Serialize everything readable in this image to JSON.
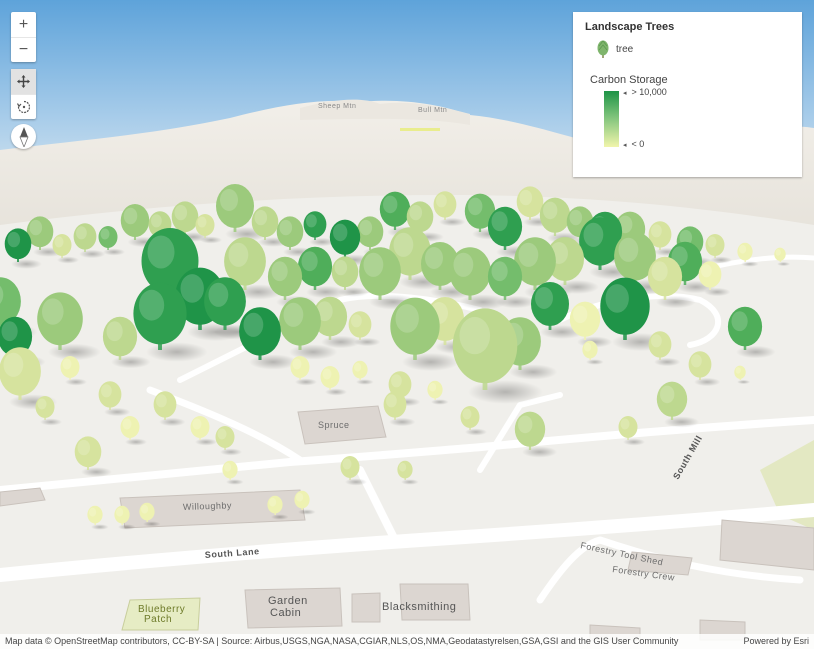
{
  "controls": {
    "zoom_in": "+",
    "zoom_out": "−",
    "pan": "pan-icon",
    "rotate": "rotate-icon",
    "compass": "compass-icon"
  },
  "legend": {
    "layer_title": "Landscape Trees",
    "symbol_label": "tree",
    "field_title": "Carbon Storage",
    "ramp_high": "> 10,000",
    "ramp_low": "< 0",
    "ramp_colors": [
      "#1e9447",
      "#7cc27a",
      "#f1f5ab"
    ]
  },
  "map_labels": {
    "spruce": "Spruce",
    "willoughby": "Willoughby",
    "south_lane": "South Lane",
    "south_mill": "South Mill",
    "forestry_tool_shed": "Forestry Tool Shed",
    "forestry_crew": "Forestry Crew",
    "garden_cabin_1": "Garden",
    "garden_cabin_2": "Cabin",
    "blacksmithing": "Blacksmithing",
    "blueberry_1": "Blueberry",
    "blueberry_2": "Patch",
    "peak_1": "Sheep Mtn",
    "peak_2": "Bull Mtn"
  },
  "attribution": {
    "text": "Map data © OpenStreetMap contributors, CC-BY-SA | Source: Airbus,USGS,NGA,NASA,CGIAR,NLS,OS,NMA,Geodatastyrelsen,GSA,GSI and the GIS User Community",
    "powered_by": "Powered by Esri"
  }
}
